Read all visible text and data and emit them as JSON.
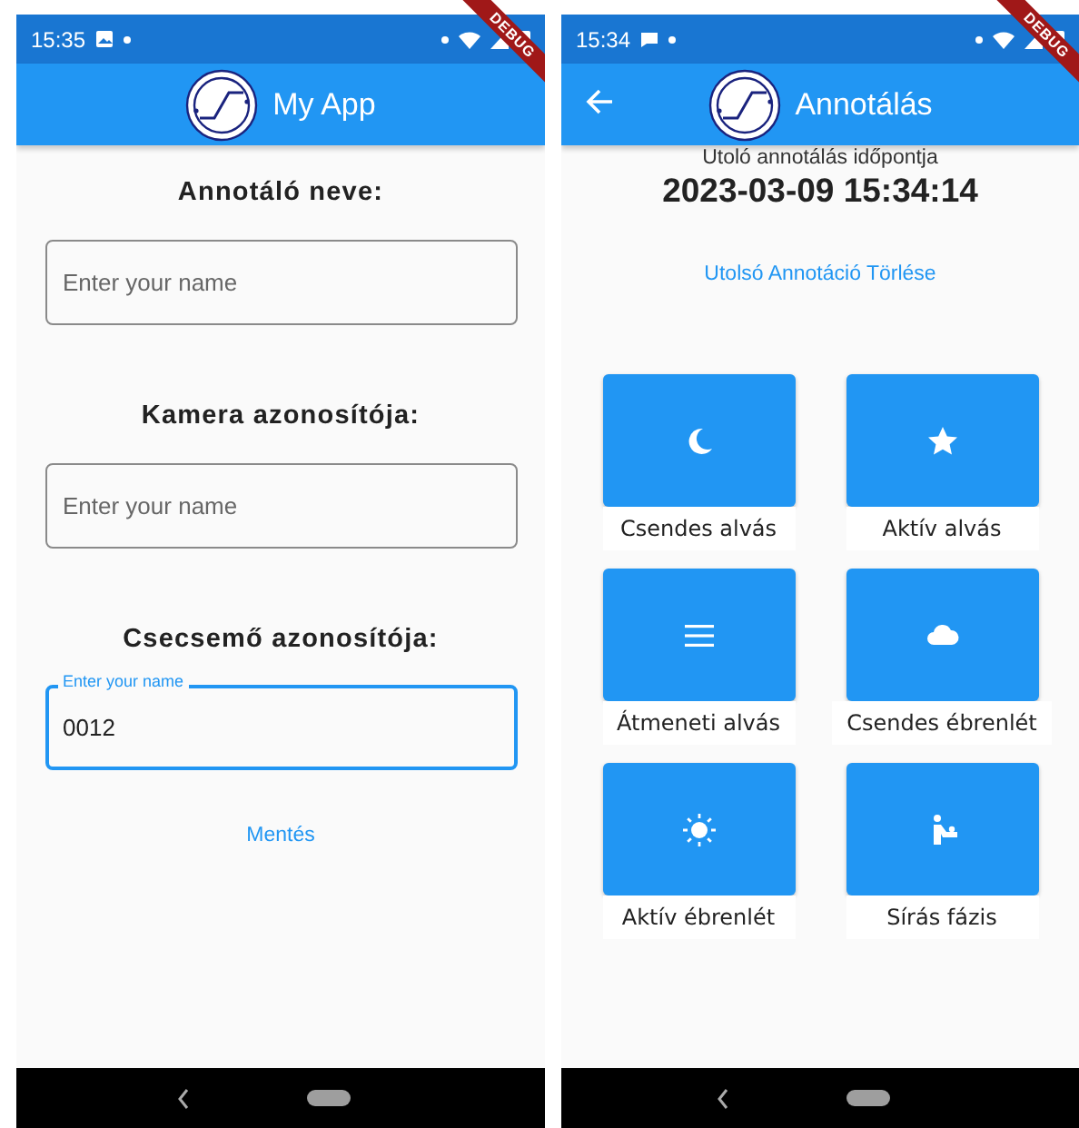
{
  "screens": [
    {
      "status_bar": {
        "time": "15:35"
      },
      "app_bar": {
        "title": "My App",
        "back_button": false
      },
      "debug_banner": "DEBUG",
      "form": {
        "fields": [
          {
            "label": "Annotáló neve:",
            "placeholder": "Enter your name",
            "focused": false
          },
          {
            "label": "Kamera azonosítója:",
            "placeholder": "Enter your name",
            "focused": false
          },
          {
            "label": "Csecsemő azonosítója:",
            "placeholder": "Enter your name",
            "value": "0012",
            "focused": true
          }
        ],
        "save_button": "Mentés"
      }
    },
    {
      "status_bar": {
        "time": "15:34"
      },
      "app_bar": {
        "title": "Annotálás",
        "back_button": true
      },
      "debug_banner": "DEBUG",
      "last_annotation": {
        "caption": "Utoló annotálás időpontja",
        "timestamp": "2023-03-09 15:34:14"
      },
      "delete_button": "Utolsó Annotáció Törlése",
      "annotations": [
        {
          "label": "Csendes alvás"
        },
        {
          "label": "Aktív alvás"
        },
        {
          "label": "Átmeneti alvás"
        },
        {
          "label": "Csendes ébrenlét"
        },
        {
          "label": "Aktív ébrenlét"
        },
        {
          "label": "Sírás fázis"
        }
      ]
    }
  ]
}
